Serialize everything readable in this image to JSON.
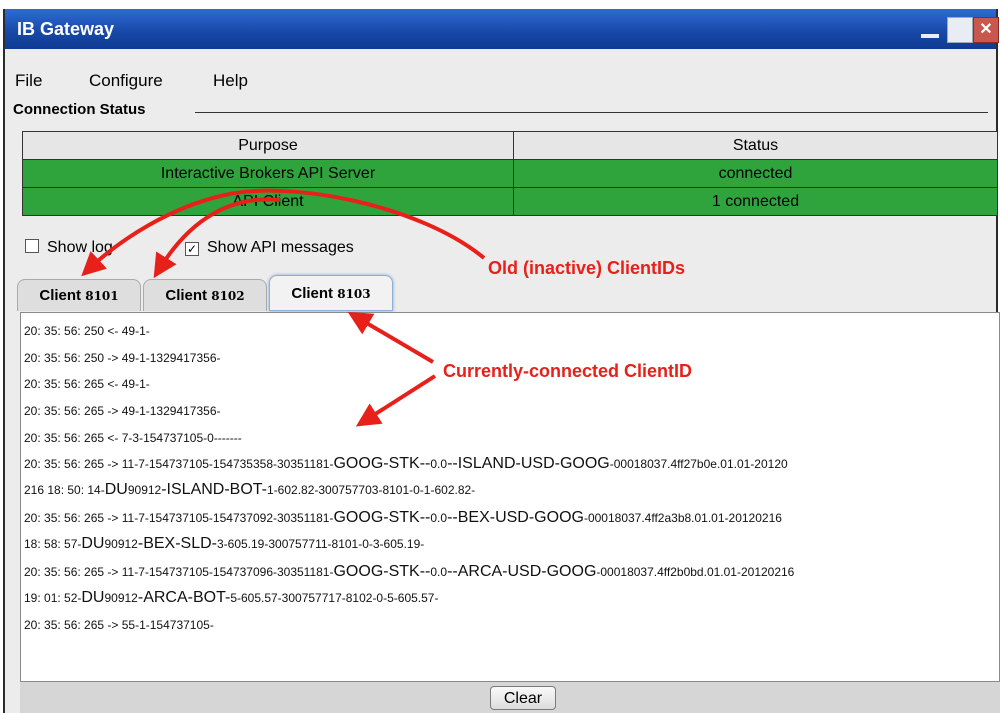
{
  "window": {
    "title": "IB Gateway"
  },
  "menu": {
    "file": "File",
    "configure": "Configure",
    "help": "Help"
  },
  "connection_status": {
    "label": "Connection Status",
    "headers": {
      "purpose": "Purpose",
      "status": "Status"
    },
    "rows": [
      {
        "purpose": "Interactive Brokers API Server",
        "status": "connected"
      },
      {
        "purpose": "API Client",
        "status": "1 connected"
      }
    ],
    "status_color": "#2fa43c"
  },
  "options": {
    "show_log": "Show log",
    "show_api_messages": "Show API messages",
    "show_log_checked": false,
    "show_api_messages_checked": true
  },
  "tabs": [
    {
      "prefix": "Client ",
      "num": "8101"
    },
    {
      "prefix": "Client ",
      "num": "8102"
    },
    {
      "prefix": "Client ",
      "num": "8103"
    }
  ],
  "active_tab": "Client 8103",
  "log": [
    {
      "a": "20: 35: 56: 250 <- 49-1-",
      "b": "",
      "c": "",
      "d": ""
    },
    {
      "a": "20: 35: 56: 250 -> 49-1-1329417356-",
      "b": "",
      "c": "",
      "d": ""
    },
    {
      "a": "20: 35: 56: 265 <- 49-1-",
      "b": "",
      "c": "",
      "d": ""
    },
    {
      "a": "20: 35: 56: 265 -> 49-1-1329417356-",
      "b": "",
      "c": "",
      "d": ""
    },
    {
      "a": "20: 35: 56: 265 <- 7-3-154737105-0-------",
      "b": "",
      "c": "",
      "d": ""
    },
    {
      "a": "20: 35: 56: 265 -> 11-7-154737105-154735358-30351181-",
      "b": "GOOG-STK--",
      "c": "0.0",
      "d": "--ISLAND-USD-GOOG",
      "e": "-00018037.4ff27b0e.01.01-20120"
    },
    {
      "a": "216 18: 50: 14-",
      "b": "DU",
      "c": "90912",
      "d": "-ISLAND-BOT-",
      "e": "1-602.82-300757703-8101-0-1-602.82-"
    },
    {
      "a": "20: 35: 56: 265 -> 11-7-154737105-154737092-30351181-",
      "b": "GOOG-STK--",
      "c": "0.0",
      "d": "--BEX-USD-GOOG",
      "e": "-00018037.4ff2a3b8.01.01-20120216"
    },
    {
      "a": "18: 58: 57-",
      "b": "DU",
      "c": "90912",
      "d": "-BEX-SLD-",
      "e": "3-605.19-300757711-8101-0-3-605.19-"
    },
    {
      "a": "20: 35: 56: 265 -> 11-7-154737105-154737096-30351181-",
      "b": "GOOG-STK--",
      "c": "0.0",
      "d": "--ARCA-USD-GOOG",
      "e": "-00018037.4ff2b0bd.01.01-20120216"
    },
    {
      "a": " 19: 01: 52-",
      "b": "DU",
      "c": "90912",
      "d": "-ARCA-BOT-",
      "e": "5-605.57-300757717-8102-0-5-605.57-"
    },
    {
      "a": "20: 35: 56: 265 -> 55-1-154737105-",
      "b": "",
      "c": "",
      "d": ""
    }
  ],
  "clear_button": "Clear",
  "annotations": {
    "old": "Old (inactive) ClientIDs",
    "current": "Currently-connected ClientID",
    "color": "#e8201a"
  }
}
